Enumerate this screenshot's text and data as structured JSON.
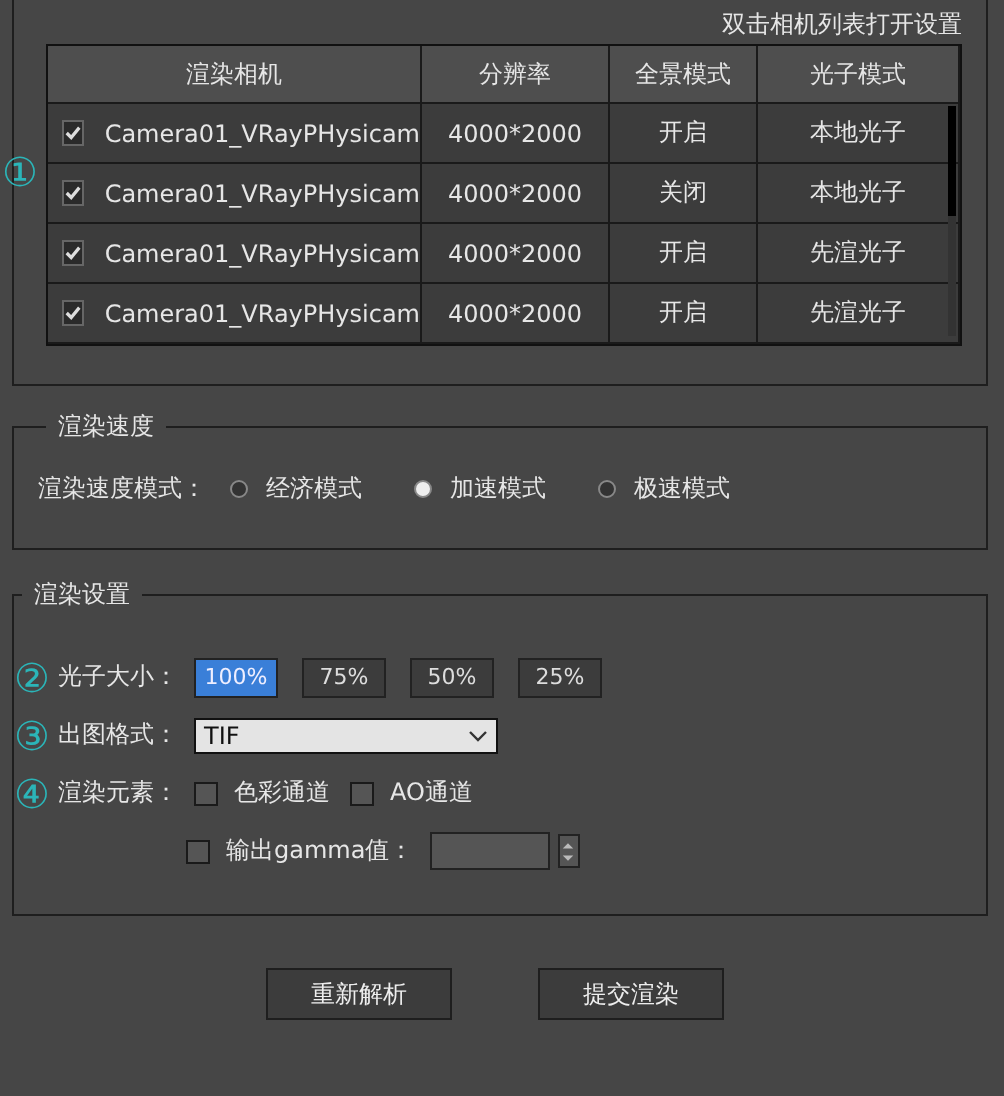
{
  "hint": "双击相机列表打开设置",
  "table": {
    "columns": [
      "渲染相机",
      "分辨率",
      "全景模式",
      "光子模式"
    ],
    "rows": [
      {
        "checked": true,
        "camera": "Camera01_VRayPHysicam",
        "resolution": "4000*2000",
        "panorama": "开启",
        "photon": "本地光子"
      },
      {
        "checked": true,
        "camera": "Camera01_VRayPHysicam",
        "resolution": "4000*2000",
        "panorama": "关闭",
        "photon": "本地光子"
      },
      {
        "checked": true,
        "camera": "Camera01_VRayPHysicam",
        "resolution": "4000*2000",
        "panorama": "开启",
        "photon": "先渲光子"
      },
      {
        "checked": true,
        "camera": "Camera01_VRayPHysicam",
        "resolution": "4000*2000",
        "panorama": "开启",
        "photon": "先渲光子"
      }
    ]
  },
  "table_marker": "①",
  "speed": {
    "title": "渲染速度",
    "label": "渲染速度模式：",
    "options": [
      {
        "label": "经济模式",
        "selected": false
      },
      {
        "label": "加速模式",
        "selected": true
      },
      {
        "label": "极速模式",
        "selected": false
      }
    ]
  },
  "settings": {
    "title": "渲染设置",
    "photon_size": {
      "marker": "②",
      "label": "光子大小：",
      "options": [
        {
          "label": "100%",
          "selected": true
        },
        {
          "label": "75%",
          "selected": false
        },
        {
          "label": "50%",
          "selected": false
        },
        {
          "label": "25%",
          "selected": false
        }
      ]
    },
    "format": {
      "marker": "③",
      "label": "出图格式：",
      "value": "TIF"
    },
    "elements": {
      "marker": "④",
      "label": "渲染元素：",
      "options": [
        {
          "label": "色彩通道",
          "checked": false
        },
        {
          "label": "AO通道",
          "checked": false
        }
      ],
      "gamma": {
        "label": "输出gamma值：",
        "checked": false
      }
    }
  },
  "buttons": [
    "重新解析",
    "提交渲染"
  ]
}
